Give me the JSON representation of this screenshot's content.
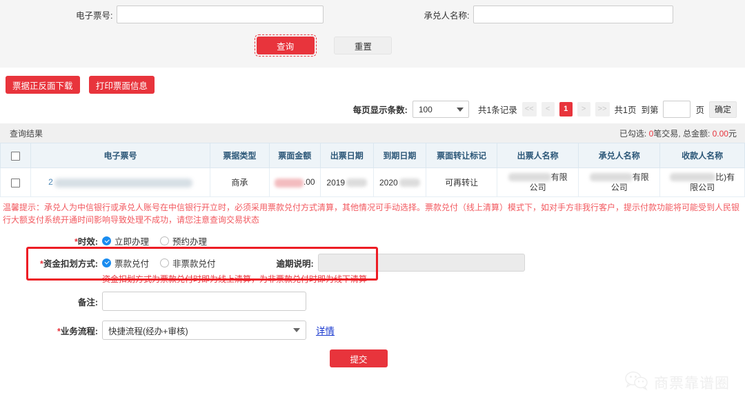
{
  "search": {
    "bill_no_label": "电子票号:",
    "bill_no_value": "",
    "acceptor_label": "承兑人名称:",
    "acceptor_value": "",
    "query_button": "查询",
    "reset_button": "重置"
  },
  "actions": {
    "download_button": "票据正反面下载",
    "print_button": "打印票面信息"
  },
  "pager": {
    "page_size_label": "每页显示条数:",
    "page_size_value": "100",
    "total_records": "共1条记录",
    "first": "<<",
    "prev": "<",
    "current_page": "1",
    "next": ">",
    "last": ">>",
    "total_pages": "共1页",
    "goto_label": "到第",
    "goto_value": "",
    "page_unit": "页",
    "confirm": "确定"
  },
  "result": {
    "title": "查询结果",
    "selected_prefix": "已勾选: ",
    "selected_count": "0",
    "selected_mid": "笔交易, 总金额: ",
    "selected_amount": "0.00",
    "selected_suffix": "元"
  },
  "table": {
    "headers": [
      "",
      "电子票号",
      "票据类型",
      "票面金额",
      "出票日期",
      "到期日期",
      "票面转让标记",
      "出票人名称",
      "承兑人名称",
      "收款人名称"
    ],
    "row": {
      "bill_no_prefix": "2",
      "bill_type": "商承",
      "amount_suffix": ".00",
      "issue_date_prefix": "2019",
      "due_date_prefix": "2020",
      "transfer_flag": "可再转让",
      "drawer_suffix": "有限公司",
      "acceptor_suffix": "有限公司",
      "payee_suffix": "北)有限公司"
    }
  },
  "warning": "温馨提示：承兑人为中信银行或承兑人账号在中信银行开立时，必须采用票款兑付方式清算，其他情况可手动选择。票款兑付（线上清算）模式下，如对手方非我行客户，提示付款功能将可能受到人民银行大额支付系统开通时间影响导致处理不成功，请您注意查询交易状态",
  "form": {
    "timing_label": "时效:",
    "timing_options": [
      "立即办理",
      "预约办理"
    ],
    "timing_selected": "立即办理",
    "payment_label": "资金扣划方式:",
    "payment_options": [
      "票款兑付",
      "非票款兑付"
    ],
    "payment_selected": "票款兑付",
    "payment_hint": "资金扣划方式为票款兑付时即为线上清算，为非票款兑付时即为线下清算",
    "overdue_label": "逾期说明:",
    "overdue_value": "",
    "remark_label": "备注:",
    "remark_value": "",
    "flow_label": "业务流程:",
    "flow_value": "快捷流程(经办+审核)",
    "detail_link": "详情",
    "submit_button": "提交",
    "required_mark": "*"
  },
  "watermark": {
    "text": "商票靠谱圈",
    "icon": "wechat-icon"
  },
  "colors": {
    "accent_red": "#e8343c",
    "link_blue": "#4a86b5",
    "radio_blue": "#1a8cf0",
    "header_bg": "#eef4f8"
  }
}
